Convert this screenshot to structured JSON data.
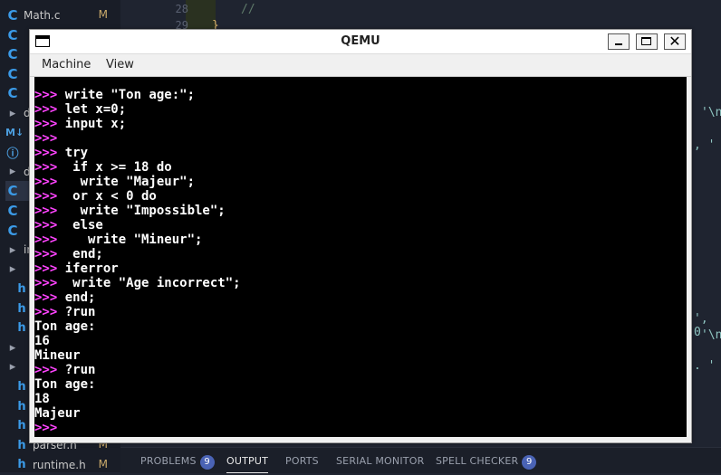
{
  "explorer": {
    "files": [
      {
        "icon": "c",
        "name": "Math.c",
        "status": "M"
      },
      {
        "icon": "c",
        "name": "",
        "status": ""
      },
      {
        "icon": "c",
        "name": "",
        "status": ""
      },
      {
        "icon": "c",
        "name": "",
        "status": ""
      },
      {
        "icon": "c",
        "name": "",
        "status": ""
      },
      {
        "icon": "f",
        "name": "do",
        "status": ""
      },
      {
        "icon": "m",
        "name": "",
        "status": ""
      },
      {
        "icon": "i",
        "name": "",
        "status": ""
      },
      {
        "icon": "f",
        "name": "dr",
        "status": ""
      },
      {
        "icon": "c",
        "name": "",
        "status": ""
      },
      {
        "icon": "c",
        "name": "",
        "status": ""
      },
      {
        "icon": "c",
        "name": "",
        "status": ""
      },
      {
        "icon": "f",
        "name": "in",
        "status": ""
      },
      {
        "icon": "f",
        "name": "",
        "status": ""
      },
      {
        "icon": "h",
        "name": "",
        "status": ""
      },
      {
        "icon": "h",
        "name": "",
        "status": ""
      },
      {
        "icon": "h",
        "name": "",
        "status": ""
      },
      {
        "icon": "f",
        "name": "",
        "status": ""
      },
      {
        "icon": "f",
        "name": "",
        "status": ""
      },
      {
        "icon": "h",
        "name": "",
        "status": ""
      },
      {
        "icon": "h",
        "name": "",
        "status": ""
      },
      {
        "icon": "h",
        "name": "",
        "status": ""
      },
      {
        "icon": "h",
        "name": "parser.h",
        "status": "M"
      },
      {
        "icon": "h",
        "name": "runtime.h",
        "status": "M"
      }
    ]
  },
  "editor": {
    "line_numbers": [
      "28",
      "29"
    ],
    "code_lines": [
      "//",
      "}"
    ],
    "edge_fragments": [
      "'\\n",
      ", '",
      "', 0",
      "'\\n",
      ". '"
    ]
  },
  "panel": {
    "tabs": [
      {
        "label": "PROBLEMS",
        "badge": "9"
      },
      {
        "label": "OUTPUT",
        "badge": ""
      },
      {
        "label": "PORTS",
        "badge": ""
      },
      {
        "label": "SERIAL MONITOR",
        "badge": ""
      },
      {
        "label": "SPELL CHECKER",
        "badge": "9"
      }
    ],
    "active_tab": "OUTPUT"
  },
  "qemu": {
    "title": "QEMU",
    "menu": [
      "Machine",
      "View"
    ],
    "terminal": [
      {
        "prompt": ">>> ",
        "text": "write \"Ton age:\";"
      },
      {
        "prompt": ">>> ",
        "text": "let x=0;"
      },
      {
        "prompt": ">>> ",
        "text": "input x;"
      },
      {
        "prompt": ">>>",
        "text": ""
      },
      {
        "prompt": ">>> ",
        "text": "try"
      },
      {
        "prompt": ">>> ",
        "text": " if x >= 18 do"
      },
      {
        "prompt": ">>> ",
        "text": "  write \"Majeur\";"
      },
      {
        "prompt": ">>> ",
        "text": " or x < 0 do"
      },
      {
        "prompt": ">>> ",
        "text": "  write \"Impossible\";"
      },
      {
        "prompt": ">>> ",
        "text": " else"
      },
      {
        "prompt": ">>> ",
        "text": "   write \"Mineur\";"
      },
      {
        "prompt": ">>> ",
        "text": " end;"
      },
      {
        "prompt": ">>> ",
        "text": "iferror"
      },
      {
        "prompt": ">>> ",
        "text": " write \"Age incorrect\";"
      },
      {
        "prompt": ">>> ",
        "text": "end;"
      },
      {
        "prompt": ">>> ",
        "text": "?run"
      },
      {
        "prompt": "",
        "text": "Ton age:"
      },
      {
        "prompt": "",
        "text": "16"
      },
      {
        "prompt": "",
        "text": "Mineur"
      },
      {
        "prompt": ">>> ",
        "text": "?run"
      },
      {
        "prompt": "",
        "text": "Ton age:"
      },
      {
        "prompt": "",
        "text": "18"
      },
      {
        "prompt": "",
        "text": "Majeur"
      },
      {
        "prompt": ">>>",
        "text": ""
      }
    ]
  }
}
